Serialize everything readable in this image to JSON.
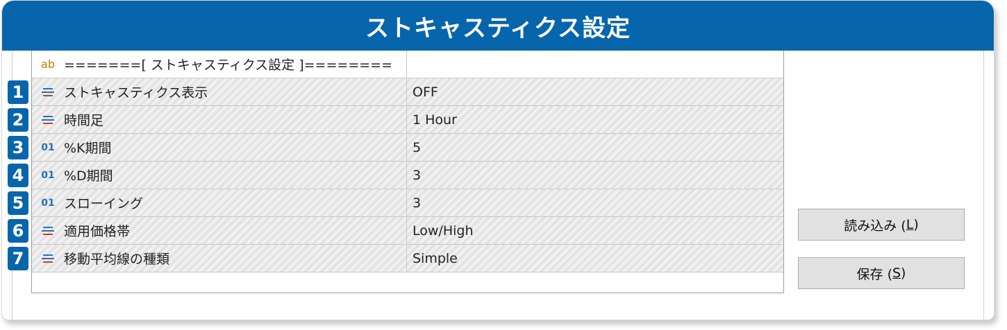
{
  "window": {
    "title": "ストキャスティクス設定"
  },
  "table": {
    "header_row": {
      "icon": "ab",
      "name": "=======[ ストキャスティクス設定 ]========",
      "value": ""
    },
    "rows": [
      {
        "badge": "1",
        "icon": "list-icon",
        "name": "ストキャスティクス表示",
        "value": "OFF"
      },
      {
        "badge": "2",
        "icon": "list-icon",
        "name": "時間足",
        "value": "1 Hour"
      },
      {
        "badge": "3",
        "icon": "01",
        "name": "%K期間",
        "value": "5"
      },
      {
        "badge": "4",
        "icon": "01",
        "name": "%D期間",
        "value": "3"
      },
      {
        "badge": "5",
        "icon": "01",
        "name": "スローイング",
        "value": "3"
      },
      {
        "badge": "6",
        "icon": "list-icon",
        "name": "適用価格帯",
        "value": "Low/High"
      },
      {
        "badge": "7",
        "icon": "list-icon",
        "name": "移動平均線の種類",
        "value": "Simple"
      }
    ]
  },
  "buttons": {
    "load": {
      "label_main": "読み込み (",
      "hotkey": "L",
      "label_end": ")"
    },
    "save": {
      "label_main": "保存 (",
      "hotkey": "S",
      "label_end": ")"
    }
  },
  "colors": {
    "accent": "#0765ac",
    "icon_orange": "#c47a00",
    "icon_blue": "#2a6fbe",
    "icon_red": "#d0392f"
  }
}
